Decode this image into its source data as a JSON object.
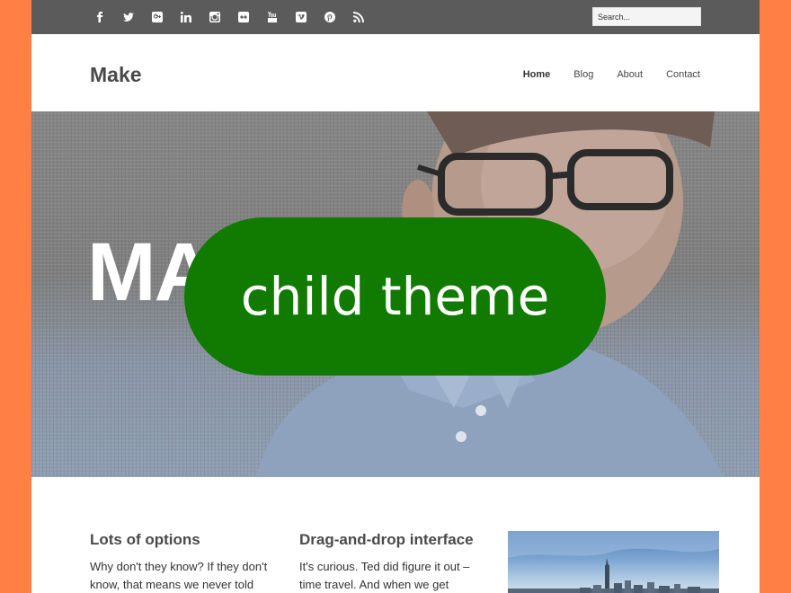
{
  "social": {
    "icons": [
      "facebook-icon",
      "twitter-icon",
      "google-plus-icon",
      "linkedin-icon",
      "instagram-icon",
      "flickr-icon",
      "youtube-icon",
      "vimeo-icon",
      "pinterest-icon",
      "rss-icon"
    ]
  },
  "search": {
    "placeholder": "Search..."
  },
  "header": {
    "logo": "Make",
    "nav": [
      {
        "label": "Home",
        "active": true
      },
      {
        "label": "Blog"
      },
      {
        "label": "About"
      },
      {
        "label": "Contact"
      }
    ]
  },
  "hero": {
    "word": "MA",
    "badge": "child theme",
    "badge_color": "#117a00"
  },
  "columns": [
    {
      "title": "Lots of options",
      "text": "Why don't they know? If they don't know, that means we never told"
    },
    {
      "title": "Drag-and-drop interface",
      "text": "It's curious. Ted did figure it out – time travel. And when we get back,"
    }
  ],
  "colors": {
    "page_bg": "#ff7f45",
    "topbar": "#5b5b5b"
  }
}
